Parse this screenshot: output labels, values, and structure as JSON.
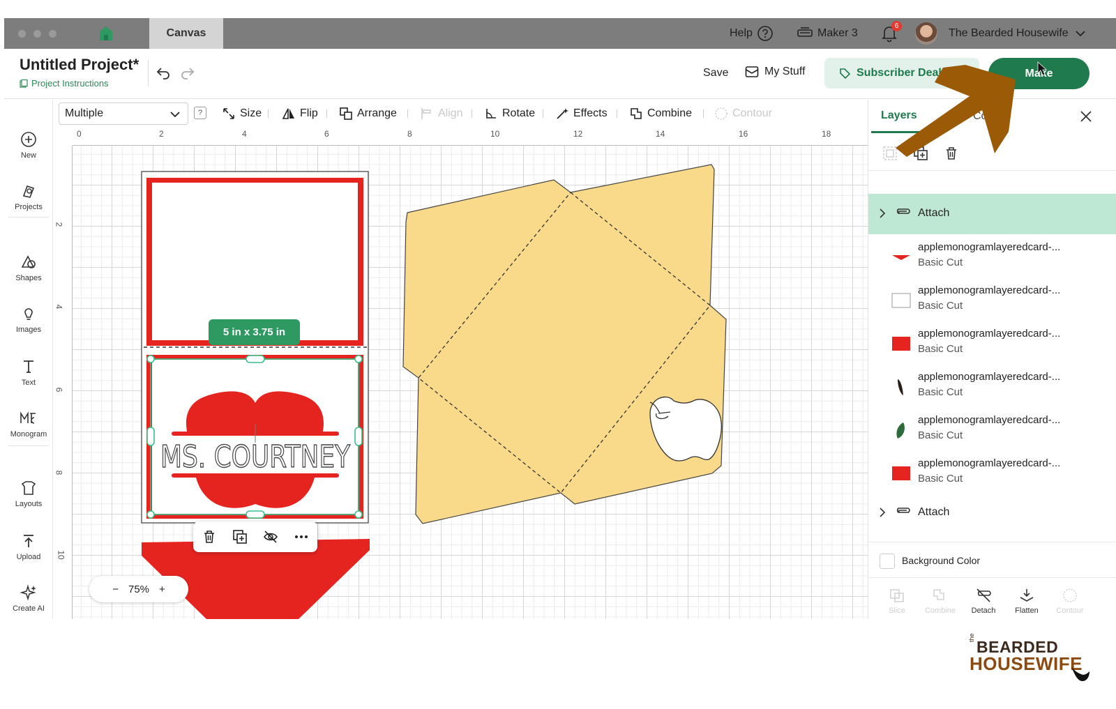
{
  "topbar": {
    "canvas_tab": "Canvas",
    "help": "Help",
    "machine": "Maker 3",
    "notifications_count": "6",
    "user_name": "The Bearded Housewife"
  },
  "header": {
    "project_title": "Untitled Project*",
    "project_instructions": "Project Instructions",
    "save": "Save",
    "my_stuff": "My Stuff",
    "subscriber": "Subscriber Deals",
    "make": "Make"
  },
  "sidebar": {
    "items": [
      {
        "label": "New",
        "icon": "plus-circle-icon"
      },
      {
        "label": "Projects",
        "icon": "projects-icon"
      },
      {
        "label": "Shapes",
        "icon": "shapes-icon"
      },
      {
        "label": "Images",
        "icon": "lightbulb-icon"
      },
      {
        "label": "Text",
        "icon": "text-icon"
      },
      {
        "label": "Monogram",
        "icon": "monogram-icon"
      },
      {
        "label": "Layouts",
        "icon": "layouts-icon"
      },
      {
        "label": "Upload",
        "icon": "upload-icon"
      },
      {
        "label": "Create AI",
        "icon": "sparkle-icon"
      }
    ]
  },
  "toolbar": {
    "select_value": "Multiple",
    "help_mark": "?",
    "size": "Size",
    "flip": "Flip",
    "arrange": "Arrange",
    "align": "Align",
    "rotate": "Rotate",
    "effects": "Effects",
    "combine": "Combine",
    "contour": "Contour"
  },
  "canvas": {
    "ruler_top": [
      "0",
      "2",
      "4",
      "6",
      "8",
      "10",
      "12",
      "14",
      "16",
      "18"
    ],
    "ruler_left": [
      "2",
      "4",
      "6",
      "8",
      "10"
    ],
    "size_badge": "5 in x 3.75 in",
    "card_text": "MS. COURTNEY",
    "zoom_minus": "−",
    "zoom": "75%",
    "zoom_plus": "+"
  },
  "panel": {
    "tab_layers": "Layers",
    "tab_colors": "Colors",
    "group_top": "Attach",
    "layers": [
      {
        "name": "applemonogramlayeredcard-...",
        "op": "Basic Cut",
        "color": "#e52420",
        "shape": "red-band"
      },
      {
        "name": "applemonogramlayeredcard-...",
        "op": "Basic Cut",
        "color": "#ffffff",
        "shape": "white-rect"
      },
      {
        "name": "applemonogramlayeredcard-...",
        "op": "Basic Cut",
        "color": "#e52420",
        "shape": "red-rect"
      },
      {
        "name": "applemonogramlayeredcard-...",
        "op": "Basic Cut",
        "color": "#2b2018",
        "shape": "stem"
      },
      {
        "name": "applemonogramlayeredcard-...",
        "op": "Basic Cut",
        "color": "#2f6b3a",
        "shape": "leaf"
      },
      {
        "name": "applemonogramlayeredcard-...",
        "op": "Basic Cut",
        "color": "#e52420",
        "shape": "red-rect"
      }
    ],
    "group_bottom": "Attach",
    "background_color": "Background Color",
    "bottom_tools": [
      {
        "label": "Slice",
        "enabled": false
      },
      {
        "label": "Combine",
        "enabled": false
      },
      {
        "label": "Detach",
        "enabled": true
      },
      {
        "label": "Flatten",
        "enabled": true
      },
      {
        "label": "Contour",
        "enabled": false
      }
    ]
  },
  "brand": {
    "the": "the",
    "line1": "BEARDED",
    "line2": "HOUSEWIFE"
  },
  "colors": {
    "accent_green": "#1f7a4d",
    "card_red": "#e52420",
    "envelope_yellow": "#f9d98a",
    "arrow_brown": "#9a5a06"
  }
}
